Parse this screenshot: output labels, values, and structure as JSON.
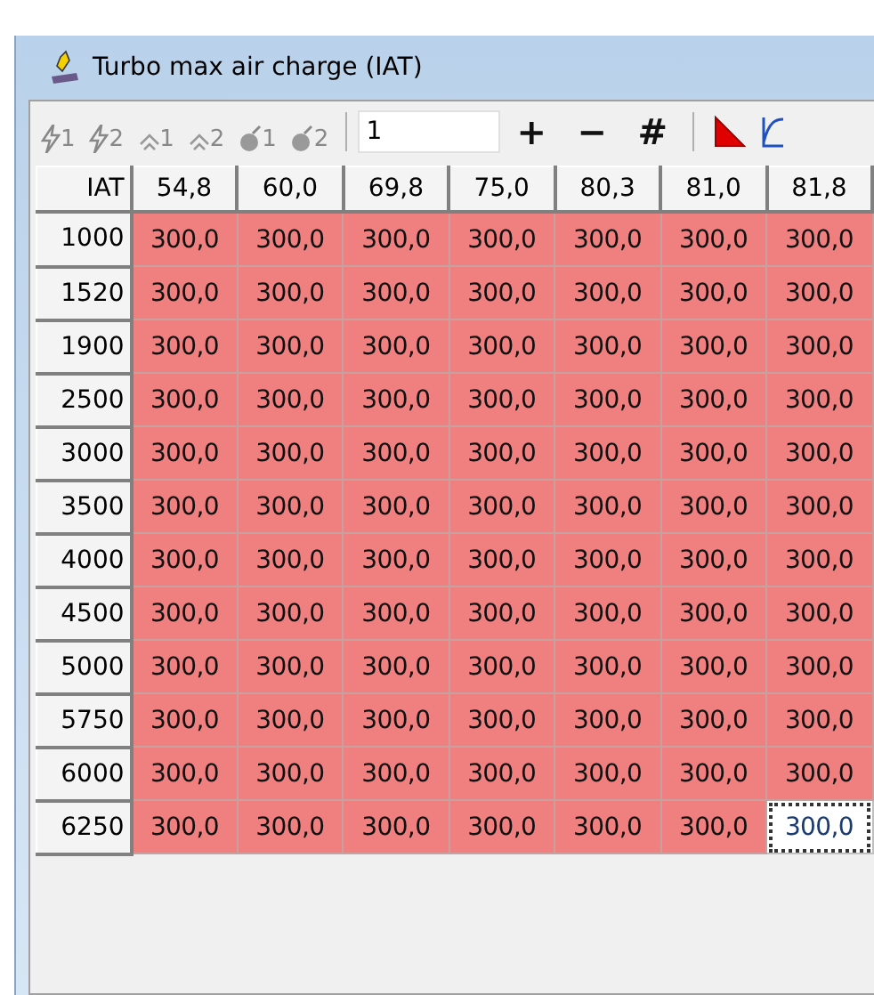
{
  "window": {
    "title": "Turbo max air charge (IAT)"
  },
  "toolbar": {
    "tools": [
      {
        "kind": "bolt",
        "index": "1"
      },
      {
        "kind": "bolt",
        "index": "2"
      },
      {
        "kind": "peak",
        "index": "1"
      },
      {
        "kind": "peak",
        "index": "2"
      },
      {
        "kind": "bomb",
        "index": "1"
      },
      {
        "kind": "bomb",
        "index": "2"
      }
    ],
    "step_value": "1",
    "actions": [
      "+",
      "−",
      "#"
    ]
  },
  "table": {
    "corner": "IAT",
    "columns": [
      "54,8",
      "60,0",
      "69,8",
      "75,0",
      "80,3",
      "81,0",
      "81,8"
    ],
    "rows": [
      {
        "label": "1000",
        "cells": [
          {
            "value": "300,0",
            "selected": false
          },
          {
            "value": "300,0",
            "selected": false
          },
          {
            "value": "300,0",
            "selected": false
          },
          {
            "value": "300,0",
            "selected": false
          },
          {
            "value": "300,0",
            "selected": false
          },
          {
            "value": "300,0",
            "selected": false
          },
          {
            "value": "300,0",
            "selected": false
          }
        ]
      },
      {
        "label": "1520",
        "cells": [
          {
            "value": "300,0",
            "selected": false
          },
          {
            "value": "300,0",
            "selected": false
          },
          {
            "value": "300,0",
            "selected": false
          },
          {
            "value": "300,0",
            "selected": false
          },
          {
            "value": "300,0",
            "selected": false
          },
          {
            "value": "300,0",
            "selected": false
          },
          {
            "value": "300,0",
            "selected": false
          }
        ]
      },
      {
        "label": "1900",
        "cells": [
          {
            "value": "300,0",
            "selected": false
          },
          {
            "value": "300,0",
            "selected": false
          },
          {
            "value": "300,0",
            "selected": false
          },
          {
            "value": "300,0",
            "selected": false
          },
          {
            "value": "300,0",
            "selected": false
          },
          {
            "value": "300,0",
            "selected": false
          },
          {
            "value": "300,0",
            "selected": false
          }
        ]
      },
      {
        "label": "2500",
        "cells": [
          {
            "value": "300,0",
            "selected": false
          },
          {
            "value": "300,0",
            "selected": false
          },
          {
            "value": "300,0",
            "selected": false
          },
          {
            "value": "300,0",
            "selected": false
          },
          {
            "value": "300,0",
            "selected": false
          },
          {
            "value": "300,0",
            "selected": false
          },
          {
            "value": "300,0",
            "selected": false
          }
        ]
      },
      {
        "label": "3000",
        "cells": [
          {
            "value": "300,0",
            "selected": false
          },
          {
            "value": "300,0",
            "selected": false
          },
          {
            "value": "300,0",
            "selected": false
          },
          {
            "value": "300,0",
            "selected": false
          },
          {
            "value": "300,0",
            "selected": false
          },
          {
            "value": "300,0",
            "selected": false
          },
          {
            "value": "300,0",
            "selected": false
          }
        ]
      },
      {
        "label": "3500",
        "cells": [
          {
            "value": "300,0",
            "selected": false
          },
          {
            "value": "300,0",
            "selected": false
          },
          {
            "value": "300,0",
            "selected": false
          },
          {
            "value": "300,0",
            "selected": false
          },
          {
            "value": "300,0",
            "selected": false
          },
          {
            "value": "300,0",
            "selected": false
          },
          {
            "value": "300,0",
            "selected": false
          }
        ]
      },
      {
        "label": "4000",
        "cells": [
          {
            "value": "300,0",
            "selected": false
          },
          {
            "value": "300,0",
            "selected": false
          },
          {
            "value": "300,0",
            "selected": false
          },
          {
            "value": "300,0",
            "selected": false
          },
          {
            "value": "300,0",
            "selected": false
          },
          {
            "value": "300,0",
            "selected": false
          },
          {
            "value": "300,0",
            "selected": false
          }
        ]
      },
      {
        "label": "4500",
        "cells": [
          {
            "value": "300,0",
            "selected": false
          },
          {
            "value": "300,0",
            "selected": false
          },
          {
            "value": "300,0",
            "selected": false
          },
          {
            "value": "300,0",
            "selected": false
          },
          {
            "value": "300,0",
            "selected": false
          },
          {
            "value": "300,0",
            "selected": false
          },
          {
            "value": "300,0",
            "selected": false
          }
        ]
      },
      {
        "label": "5000",
        "cells": [
          {
            "value": "300,0",
            "selected": false
          },
          {
            "value": "300,0",
            "selected": false
          },
          {
            "value": "300,0",
            "selected": false
          },
          {
            "value": "300,0",
            "selected": false
          },
          {
            "value": "300,0",
            "selected": false
          },
          {
            "value": "300,0",
            "selected": false
          },
          {
            "value": "300,0",
            "selected": false
          }
        ]
      },
      {
        "label": "5750",
        "cells": [
          {
            "value": "300,0",
            "selected": false
          },
          {
            "value": "300,0",
            "selected": false
          },
          {
            "value": "300,0",
            "selected": false
          },
          {
            "value": "300,0",
            "selected": false
          },
          {
            "value": "300,0",
            "selected": false
          },
          {
            "value": "300,0",
            "selected": false
          },
          {
            "value": "300,0",
            "selected": false
          }
        ]
      },
      {
        "label": "6000",
        "cells": [
          {
            "value": "300,0",
            "selected": false
          },
          {
            "value": "300,0",
            "selected": false
          },
          {
            "value": "300,0",
            "selected": false
          },
          {
            "value": "300,0",
            "selected": false
          },
          {
            "value": "300,0",
            "selected": false
          },
          {
            "value": "300,0",
            "selected": false
          },
          {
            "value": "300,0",
            "selected": false
          }
        ]
      },
      {
        "label": "6250",
        "cells": [
          {
            "value": "300,0",
            "selected": false
          },
          {
            "value": "300,0",
            "selected": false
          },
          {
            "value": "300,0",
            "selected": false
          },
          {
            "value": "300,0",
            "selected": false
          },
          {
            "value": "300,0",
            "selected": false
          },
          {
            "value": "300,0",
            "selected": false
          },
          {
            "value": "300,0",
            "selected": true
          }
        ]
      }
    ]
  }
}
